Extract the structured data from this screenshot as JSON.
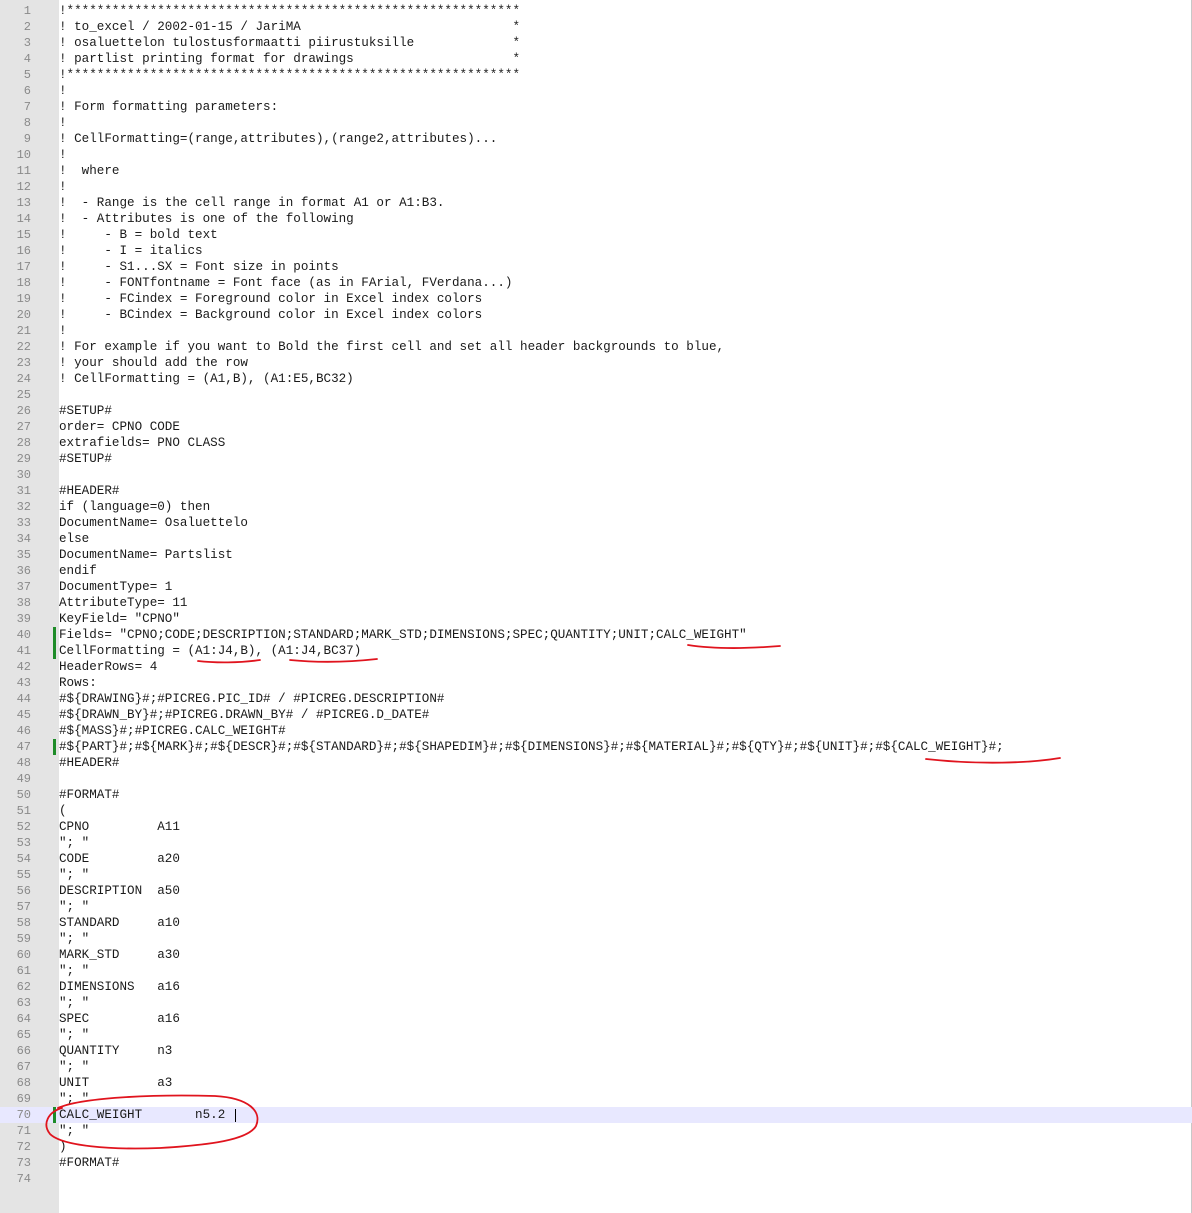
{
  "editor": {
    "lines": [
      {
        "n": "1",
        "text": "!************************************************************"
      },
      {
        "n": "2",
        "text": "! to_excel / 2002-01-15 / JariMA                            *"
      },
      {
        "n": "3",
        "text": "! osaluettelon tulostusformaatti piirustuksille             *"
      },
      {
        "n": "4",
        "text": "! partlist printing format for drawings                     *"
      },
      {
        "n": "5",
        "text": "!************************************************************"
      },
      {
        "n": "6",
        "text": "!"
      },
      {
        "n": "7",
        "text": "! Form formatting parameters:"
      },
      {
        "n": "8",
        "text": "!"
      },
      {
        "n": "9",
        "text": "! CellFormatting=(range,attributes),(range2,attributes)..."
      },
      {
        "n": "10",
        "text": "!"
      },
      {
        "n": "11",
        "text": "!  where"
      },
      {
        "n": "12",
        "text": "!"
      },
      {
        "n": "13",
        "text": "!  - Range is the cell range in format A1 or A1:B3."
      },
      {
        "n": "14",
        "text": "!  - Attributes is one of the following"
      },
      {
        "n": "15",
        "text": "!     - B = bold text"
      },
      {
        "n": "16",
        "text": "!     - I = italics"
      },
      {
        "n": "17",
        "text": "!     - S1...SX = Font size in points"
      },
      {
        "n": "18",
        "text": "!     - FONTfontname = Font face (as in FArial, FVerdana...)"
      },
      {
        "n": "19",
        "text": "!     - FCindex = Foreground color in Excel index colors"
      },
      {
        "n": "20",
        "text": "!     - BCindex = Background color in Excel index colors"
      },
      {
        "n": "21",
        "text": "!"
      },
      {
        "n": "22",
        "text": "! For example if you want to Bold the first cell and set all header backgrounds to blue,"
      },
      {
        "n": "23",
        "text": "! your should add the row"
      },
      {
        "n": "24",
        "text": "! CellFormatting = (A1,B), (A1:E5,BC32)"
      },
      {
        "n": "25",
        "text": ""
      },
      {
        "n": "26",
        "text": "#SETUP#"
      },
      {
        "n": "27",
        "text": "order= CPNO CODE"
      },
      {
        "n": "28",
        "text": "extrafields= PNO CLASS"
      },
      {
        "n": "29",
        "text": "#SETUP#"
      },
      {
        "n": "30",
        "text": ""
      },
      {
        "n": "31",
        "text": "#HEADER#"
      },
      {
        "n": "32",
        "text": "if (language=0) then"
      },
      {
        "n": "33",
        "text": "DocumentName= Osaluettelo"
      },
      {
        "n": "34",
        "text": "else"
      },
      {
        "n": "35",
        "text": "DocumentName= Partslist"
      },
      {
        "n": "36",
        "text": "endif"
      },
      {
        "n": "37",
        "text": "DocumentType= 1"
      },
      {
        "n": "38",
        "text": "AttributeType= 11"
      },
      {
        "n": "39",
        "text": "KeyField= \"CPNO\""
      },
      {
        "n": "40",
        "text": "Fields= \"CPNO;CODE;DESCRIPTION;STANDARD;MARK_STD;DIMENSIONS;SPEC;QUANTITY;UNIT;CALC_WEIGHT\"",
        "changed": true
      },
      {
        "n": "41",
        "text": "CellFormatting = (A1:J4,B), (A1:J4,BC37)",
        "changed": true
      },
      {
        "n": "42",
        "text": "HeaderRows= 4"
      },
      {
        "n": "43",
        "text": "Rows:"
      },
      {
        "n": "44",
        "text": "#${DRAWING}#;#PICREG.PIC_ID# / #PICREG.DESCRIPTION#"
      },
      {
        "n": "45",
        "text": "#${DRAWN_BY}#;#PICREG.DRAWN_BY# / #PICREG.D_DATE#"
      },
      {
        "n": "46",
        "text": "#${MASS}#;#PICREG.CALC_WEIGHT#"
      },
      {
        "n": "47",
        "text": "#${PART}#;#${MARK}#;#${DESCR}#;#${STANDARD}#;#${SHAPEDIM}#;#${DIMENSIONS}#;#${MATERIAL}#;#${QTY}#;#${UNIT}#;#${CALC_WEIGHT}#;",
        "changed": true
      },
      {
        "n": "48",
        "text": "#HEADER#"
      },
      {
        "n": "49",
        "text": ""
      },
      {
        "n": "50",
        "text": "#FORMAT#"
      },
      {
        "n": "51",
        "text": "("
      },
      {
        "n": "52",
        "text": "CPNO         A11"
      },
      {
        "n": "53",
        "text": "\"; \""
      },
      {
        "n": "54",
        "text": "CODE         a20"
      },
      {
        "n": "55",
        "text": "\"; \""
      },
      {
        "n": "56",
        "text": "DESCRIPTION  a50"
      },
      {
        "n": "57",
        "text": "\"; \""
      },
      {
        "n": "58",
        "text": "STANDARD     a10"
      },
      {
        "n": "59",
        "text": "\"; \""
      },
      {
        "n": "60",
        "text": "MARK_STD     a30"
      },
      {
        "n": "61",
        "text": "\"; \""
      },
      {
        "n": "62",
        "text": "DIMENSIONS   a16"
      },
      {
        "n": "63",
        "text": "\"; \""
      },
      {
        "n": "64",
        "text": "SPEC         a16"
      },
      {
        "n": "65",
        "text": "\"; \""
      },
      {
        "n": "66",
        "text": "QUANTITY     n3"
      },
      {
        "n": "67",
        "text": "\"; \""
      },
      {
        "n": "68",
        "text": "UNIT         a3"
      },
      {
        "n": "69",
        "text": "\"; \""
      },
      {
        "n": "70",
        "text": "CALC_WEIGHT       n5.2",
        "changed": true,
        "current": true
      },
      {
        "n": "71",
        "text": "\"; \""
      },
      {
        "n": "72",
        "text": ")"
      },
      {
        "n": "73",
        "text": "#FORMAT#"
      },
      {
        "n": "74",
        "text": ""
      }
    ]
  },
  "colors": {
    "gutter_bg": "#e4e4e4",
    "line_number": "#8a8a8a",
    "change_marker": "#1e8c28",
    "current_line_bg": "#e8e8ff",
    "annotation": "#e0141e"
  },
  "annotations": [
    "underline-calc-weight-fields",
    "underline-cellformatting-ranges",
    "underline-calc-weight-row",
    "circle-calc-weight-format"
  ]
}
